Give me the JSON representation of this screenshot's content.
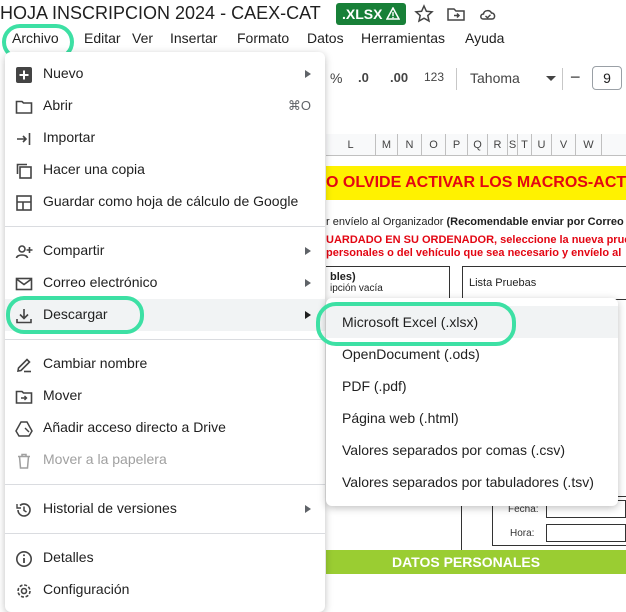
{
  "title_bar": {
    "doc_title": "HOJA INSCRIPCION 2024 - CAEX-CAT",
    "badge": ".XLSX",
    "badge_color": "#188038",
    "icons": [
      "warning-icon",
      "star-icon",
      "move-folder-icon",
      "cloud-status-icon"
    ]
  },
  "menubar": {
    "items": [
      "Archivo",
      "Editar",
      "Ver",
      "Insertar",
      "Formato",
      "Datos",
      "Herramientas",
      "Ayuda"
    ]
  },
  "toolbar": {
    "percent": "%",
    "dec_decrease": ".0",
    "dec_increase": ".00",
    "number_format": "123",
    "font": "Tahoma",
    "size_minus": "−",
    "font_size": "9"
  },
  "sheet": {
    "columns": [
      "L",
      "M",
      "N",
      "O",
      "P",
      "Q",
      "R",
      "S",
      "T",
      "U",
      "V",
      "W"
    ],
    "banner": "O OLVIDE ACTIVAR LOS MACROS-ACT",
    "line1_normal": "r envíelo al Organizador",
    "line1_bold": "(Recomendable enviar por Correo e",
    "line2": "UARDADO EN SU ORDENADOR, seleccione la nueva prueb",
    "line3": "personales o del vehículo que sea necesario y envíelo al",
    "box_left_title": "bles)",
    "box_left_sub": "ipción vacía",
    "box_right": "Lista Pruebas",
    "fecha": "Fecha:",
    "hora": "Hora:",
    "green_bar": "DATOS PERSONALES"
  },
  "file_menu": {
    "items": [
      {
        "label": "Nuevo",
        "icon": "plus-square-icon",
        "submenu": true
      },
      {
        "label": "Abrir",
        "icon": "folder-icon",
        "shortcut": "⌘O"
      },
      {
        "label": "Importar",
        "icon": "import-icon"
      },
      {
        "label": "Hacer una copia",
        "icon": "copy-icon"
      },
      {
        "label": "Guardar como hoja de cálculo de Google",
        "icon": "save-sheet-icon"
      },
      {
        "label": "Compartir",
        "icon": "person-add-icon",
        "submenu": true
      },
      {
        "label": "Correo electrónico",
        "icon": "mail-icon",
        "submenu": true
      },
      {
        "label": "Descargar",
        "icon": "download-icon",
        "submenu": true
      },
      {
        "label": "Cambiar nombre",
        "icon": "rename-icon"
      },
      {
        "label": "Mover",
        "icon": "move-folder-icon"
      },
      {
        "label": "Añadir acceso directo a Drive",
        "icon": "drive-shortcut-icon"
      },
      {
        "label": "Mover a la papelera",
        "icon": "trash-icon",
        "disabled": true
      },
      {
        "label": "Historial de versiones",
        "icon": "history-icon",
        "submenu": true
      },
      {
        "label": "Detalles",
        "icon": "info-icon"
      },
      {
        "label": "Configuración",
        "icon": "gear-icon"
      }
    ]
  },
  "download_submenu": {
    "items": [
      "Microsoft Excel (.xlsx)",
      "OpenDocument (.ods)",
      "PDF (.pdf)",
      "Página web (.html)",
      "Valores separados por comas (.csv)",
      "Valores separados por tabuladores (.tsv)"
    ]
  },
  "highlight_color": "#3de0a4"
}
